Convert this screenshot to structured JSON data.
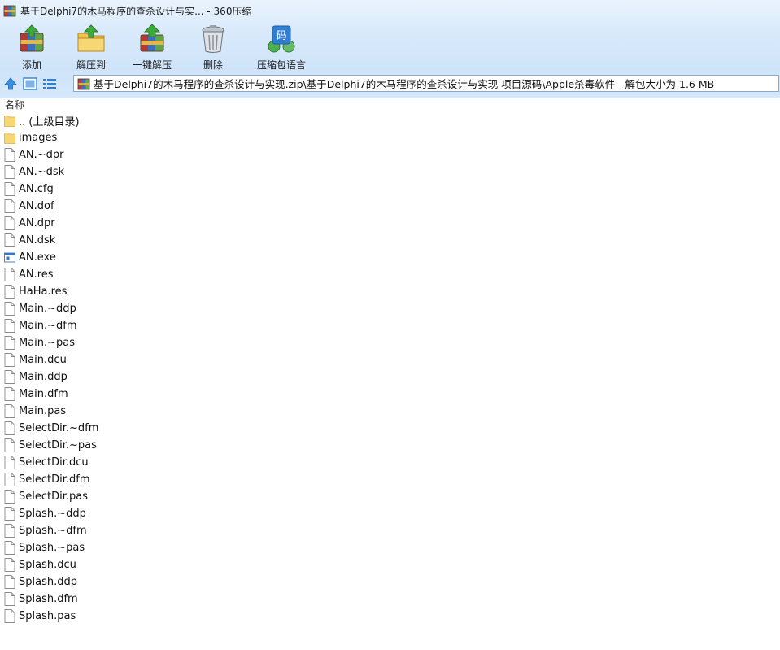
{
  "window": {
    "title": "基于Delphi7的木马程序的查杀设计与实... - 360压缩"
  },
  "toolbar": {
    "items": [
      {
        "label": "添加",
        "icon": "add-archive-icon"
      },
      {
        "label": "解压到",
        "icon": "extract-to-icon"
      },
      {
        "label": "一键解压",
        "icon": "one-click-extract-icon"
      },
      {
        "label": "删除",
        "icon": "delete-trash-icon"
      },
      {
        "label": "压缩包语言",
        "icon": "archive-language-icon"
      }
    ]
  },
  "address": {
    "path": "基于Delphi7的木马程序的查杀设计与实现.zip\\基于Delphi7的木马程序的查杀设计与实现 项目源码\\Apple杀毒软件 - 解包大小为 1.6 MB"
  },
  "list": {
    "column_name": "名称",
    "files": [
      {
        "name": ".. (上级目录)",
        "type": "folder"
      },
      {
        "name": "images",
        "type": "folder"
      },
      {
        "name": "AN.~dpr",
        "type": "file"
      },
      {
        "name": "AN.~dsk",
        "type": "file"
      },
      {
        "name": "AN.cfg",
        "type": "file"
      },
      {
        "name": "AN.dof",
        "type": "file"
      },
      {
        "name": "AN.dpr",
        "type": "file"
      },
      {
        "name": "AN.dsk",
        "type": "file"
      },
      {
        "name": "AN.exe",
        "type": "exe"
      },
      {
        "name": "AN.res",
        "type": "file"
      },
      {
        "name": "HaHa.res",
        "type": "file"
      },
      {
        "name": "Main.~ddp",
        "type": "file"
      },
      {
        "name": "Main.~dfm",
        "type": "file"
      },
      {
        "name": "Main.~pas",
        "type": "file"
      },
      {
        "name": "Main.dcu",
        "type": "file"
      },
      {
        "name": "Main.ddp",
        "type": "file"
      },
      {
        "name": "Main.dfm",
        "type": "file"
      },
      {
        "name": "Main.pas",
        "type": "file"
      },
      {
        "name": "SelectDir.~dfm",
        "type": "file"
      },
      {
        "name": "SelectDir.~pas",
        "type": "file"
      },
      {
        "name": "SelectDir.dcu",
        "type": "file"
      },
      {
        "name": "SelectDir.dfm",
        "type": "file"
      },
      {
        "name": "SelectDir.pas",
        "type": "file"
      },
      {
        "name": "Splash.~ddp",
        "type": "file"
      },
      {
        "name": "Splash.~dfm",
        "type": "file"
      },
      {
        "name": "Splash.~pas",
        "type": "file"
      },
      {
        "name": "Splash.dcu",
        "type": "file"
      },
      {
        "name": "Splash.ddp",
        "type": "file"
      },
      {
        "name": "Splash.dfm",
        "type": "file"
      },
      {
        "name": "Splash.pas",
        "type": "file"
      }
    ]
  },
  "colors": {
    "chrome_top": "#e9f3fd",
    "chrome_bottom": "#d6e8fb",
    "folder": "#f7d674",
    "accent_blue": "#3b8fd9"
  }
}
